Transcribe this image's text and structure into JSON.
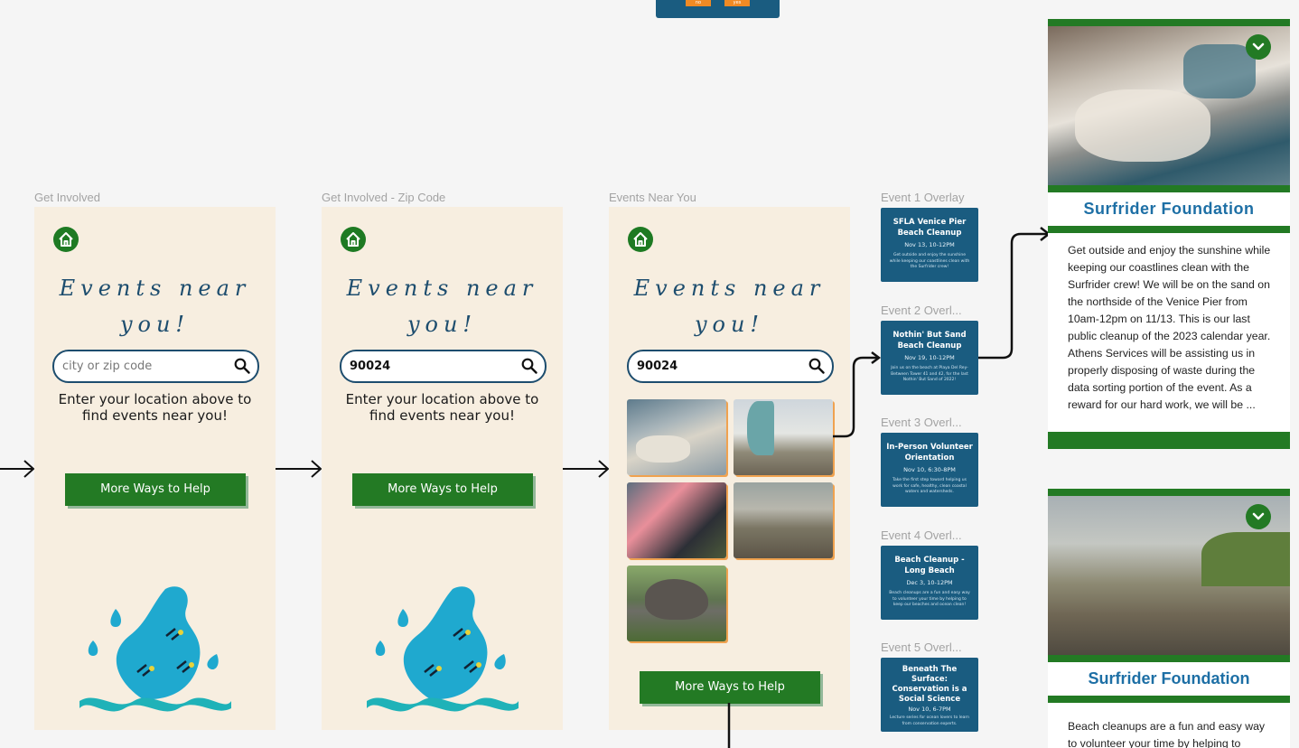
{
  "frames": {
    "f1": {
      "label": "Get Involved"
    },
    "f2": {
      "label": "Get Involved - Zip Code"
    },
    "f3": {
      "label": "Events Near You"
    }
  },
  "app": {
    "title": "Events near you!",
    "title_line1": "Events near",
    "title_line2": "you!",
    "search_placeholder": "city or zip code",
    "zip_value": "90024",
    "helper_text": "Enter your location above to find events near you!",
    "cta_label": "More Ways to Help"
  },
  "events": [
    {
      "overlay_label": "Event 1 Overlay",
      "title": "SFLA Venice Pier Beach Cleanup",
      "date": "Nov 13, 10-12PM",
      "blurb": "Get outside and enjoy the sunshine while keeping our coastlines clean with the Surfrider crew!"
    },
    {
      "overlay_label": "Event 2 Overl...",
      "title": "Nothin' But Sand Beach Cleanup",
      "date": "Nov 19, 10-12PM",
      "blurb": "Join us on the beach at Playa Del Rey-Between Tower 41 and 42, for the last Nothin' But Sand of 2022!"
    },
    {
      "overlay_label": "Event 3 Overl...",
      "title": "In-Person Volunteer Orientation",
      "date": "Nov 10, 6:30-8PM",
      "blurb": "Take the first step toward helping us work for safe, healthy, clean coastal waters and watersheds."
    },
    {
      "overlay_label": "Event 4 Overl...",
      "title": "Beach Cleanup - Long Beach",
      "date": "Dec 3, 10-12PM",
      "blurb": "Beach cleanups are a fun and easy way to volunteer your time by helping to keep our beaches and ocean clean!"
    },
    {
      "overlay_label": "Event 5 Overl...",
      "title": "Beneath The Surface: Conservation is a Social Science",
      "date": "Nov 10, 6-7PM",
      "blurb": "Lecture series for ocean lovers to learn from conservation experts."
    }
  ],
  "details": [
    {
      "org": "Surfrider Foundation",
      "description": "Get outside and enjoy the sunshine while keeping our coastlines clean with the Surfrider crew! We will be on the sand on the northside of the Venice Pier from 10am-12pm on 11/13. This is our last public cleanup of the 2023 calendar year. Athens Services will be assisting us in properly disposing of waste during the data sorting portion of the event. As a reward for our hard work, we will be ..."
    },
    {
      "org": "Surfrider Foundation",
      "description": "Beach cleanups are a fun and easy way to volunteer your time by helping to"
    }
  ],
  "top_buttons": {
    "no": "no",
    "yes": "yes"
  },
  "colors": {
    "brand_green": "#237a24",
    "navy": "#1a5c80",
    "cream": "#f7eee0",
    "accent_orange": "#f0a24f",
    "link_blue": "#1d6fa5"
  }
}
